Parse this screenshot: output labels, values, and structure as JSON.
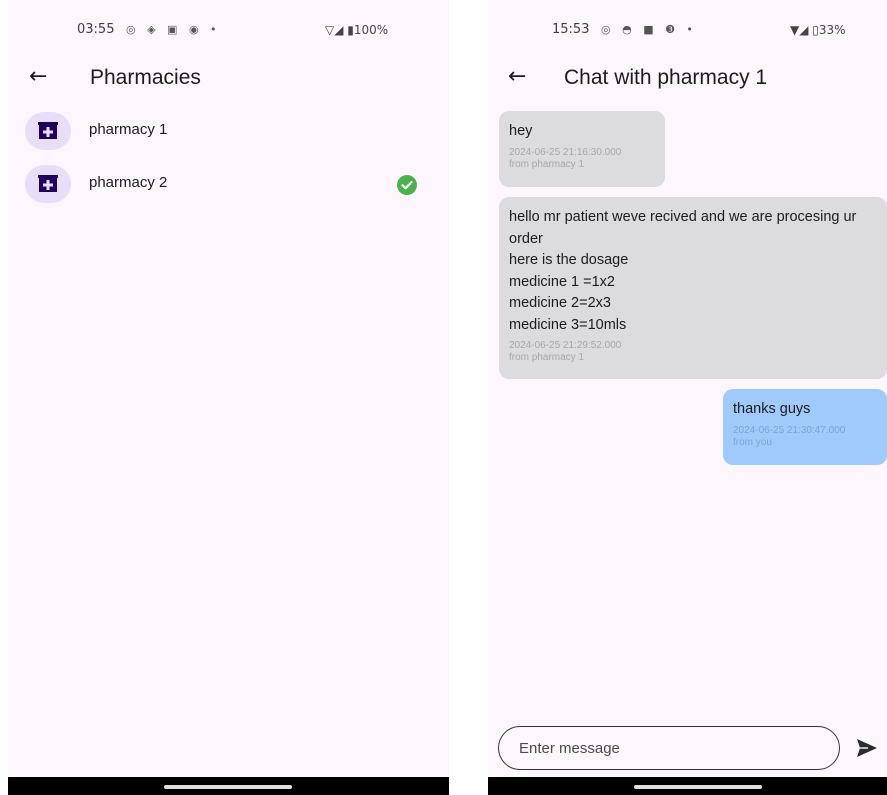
{
  "left_screen": {
    "status_bar": {
      "time": "03:55",
      "icons": "◎ ◈ ▣ ◉ •",
      "right": "▽◢ ▮100%"
    },
    "title": "Pharmacies",
    "back_icon": "←",
    "items": [
      {
        "label": "pharmacy 1",
        "icon": "pharmacy-icon",
        "selected": false
      },
      {
        "label": "pharmacy 2",
        "icon": "pharmacy-icon",
        "selected": true
      }
    ],
    "colors": {
      "avatar_bg": "#e8def8",
      "avatar_icon": "#21005d",
      "check": "#4caf50",
      "background": "#fdf7fd"
    }
  },
  "right_screen": {
    "status_bar": {
      "time": "15:53",
      "icons": "◎ ◓ ■ ❸ •",
      "right": "▼◢ ▯33%"
    },
    "title": "Chat with pharmacy 1",
    "back_icon": "←",
    "messages": [
      {
        "text": "hey",
        "timestamp": "2024-06-25 21:16:30.000",
        "sender": "from pharmacy 1",
        "direction": "incoming"
      },
      {
        "text": "hello mr patient weve recived and we are procesing ur order\nhere is the dosage\nmedicine 1 =1x2\nmedicine 2=2x3\nmedicine 3=10mls",
        "timestamp": "2024-06-25 21:29:52.000",
        "sender": "from pharmacy 1",
        "direction": "incoming"
      },
      {
        "text": "thanks guys",
        "timestamp": "2024-06-25 21:30:47.000",
        "sender": "from you",
        "direction": "outgoing"
      }
    ],
    "input": {
      "placeholder": "Enter message",
      "value": ""
    },
    "send_icon": "send-icon",
    "colors": {
      "incoming_bubble": "#dcdbdd",
      "outgoing_bubble": "#9fcaf9"
    }
  }
}
